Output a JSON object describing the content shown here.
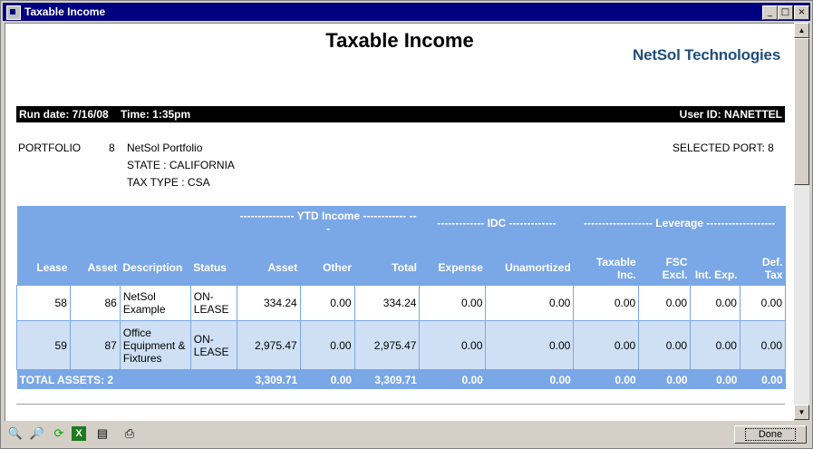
{
  "window": {
    "title": "Taxable Income"
  },
  "report": {
    "title": "Taxable Income",
    "logo": "NetSol Technologies",
    "run_line": "Run date: 7/16/08    Time: 1:35pm",
    "user_line": "User ID: NANETTEL",
    "portfolio_label": "PORTFOLIO",
    "portfolio_number": "8",
    "portfolio_name": "NetSol Portfolio",
    "state": "STATE : CALIFORNIA",
    "tax_type": "TAX TYPE : CSA",
    "selected_port": "SELECTED PORT: 8"
  },
  "table": {
    "groups": {
      "ytd": "--------------- YTD Income ------------ ---",
      "idc": "------------- IDC -------------",
      "leverage": "------------------- Leverage -------------------"
    },
    "headers": {
      "lease": "Lease",
      "asset": "Asset",
      "description": "Description",
      "status": "Status",
      "ytd_asset": "Asset",
      "ytd_other": "Other",
      "ytd_total": "Total",
      "expense": "Expense",
      "unamortized": "Unamortized",
      "taxable_inc": "Taxable Inc.",
      "fsc_excl": "FSC Excl.",
      "int_exp": "Int. Exp.",
      "def_tax": "Def. Tax"
    },
    "rows": [
      {
        "lease": "58",
        "asset": "86",
        "description": "NetSol Example",
        "status": "ON-LEASE",
        "ytd_asset": "334.24",
        "ytd_other": "0.00",
        "ytd_total": "334.24",
        "expense": "0.00",
        "unamortized": "0.00",
        "taxable_inc": "0.00",
        "fsc_excl": "0.00",
        "int_exp": "0.00",
        "def_tax": "0.00"
      },
      {
        "lease": "59",
        "asset": "87",
        "description": "Office Equipment & Fixtures",
        "status": "ON-LEASE",
        "ytd_asset": "2,975.47",
        "ytd_other": "0.00",
        "ytd_total": "2,975.47",
        "expense": "0.00",
        "unamortized": "0.00",
        "taxable_inc": "0.00",
        "fsc_excl": "0.00",
        "int_exp": "0.00",
        "def_tax": "0.00"
      }
    ],
    "total": {
      "label": "TOTAL ASSETS: 2",
      "ytd_asset": "3,309.71",
      "ytd_other": "0.00",
      "ytd_total": "3,309.71",
      "expense": "0.00",
      "unamortized": "0.00",
      "taxable_inc": "0.00",
      "fsc_excl": "0.00",
      "int_exp": "0.00",
      "def_tax": "0.00"
    }
  },
  "toolbar": {
    "tools": [
      "zoom-out-icon",
      "zoom-in-icon",
      "refresh-icon",
      "excel-export-icon",
      "print-preview-icon",
      "print-icon"
    ],
    "done_label": "Done"
  }
}
